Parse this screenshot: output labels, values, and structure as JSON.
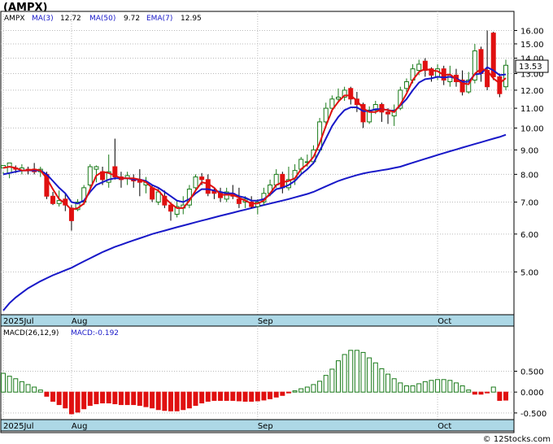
{
  "title": "(AMPX)",
  "watermark": "© 12Stocks.com",
  "colors": {
    "up": "#1a7a1a",
    "down": "#e01010",
    "ma3": "#e01010",
    "ma50": "#1818c8",
    "ema7": "#1818c8",
    "axisband": "#add8e6",
    "grid": "#bbbbbb",
    "macd_pos": "#1a7a1a",
    "macd_neg": "#e01010"
  },
  "legend": {
    "symbol": "AMPX",
    "ma3_label": "MA(3)",
    "ma3_value": "12.72",
    "ma50_label": "MA(50)",
    "ma50_value": "9.72",
    "ema7_label": "EMA(7)",
    "ema7_value": "12.95"
  },
  "macd_legend": {
    "label": "MACD(26,12,9)",
    "value_label": "MACD:-0.192"
  },
  "last_price_label": "13.53",
  "chart_data": [
    {
      "type": "candlestick",
      "title": "(AMPX)",
      "y_scale": "log",
      "ylim": [
        4.1,
        17.0
      ],
      "yticks": [
        "16.00",
        "15.00",
        "14.00",
        "13.00",
        "12.00",
        "11.00",
        "10.00",
        "9.00",
        "8.00",
        "7.00",
        "6.00",
        "5.00"
      ],
      "ytick_values": [
        16,
        15,
        14,
        13,
        12,
        11,
        10,
        9,
        8,
        7,
        6,
        5
      ],
      "xticks": [
        {
          "label": "2025Jul",
          "index": 0
        },
        {
          "label": "Aug",
          "index": 11
        },
        {
          "label": "Sep",
          "index": 41
        },
        {
          "label": "Oct",
          "index": 70
        }
      ],
      "candles": [
        [
          8.25,
          8.35,
          8.1,
          8.0
        ],
        [
          8.05,
          8.45,
          8.25,
          7.85
        ],
        [
          8.25,
          8.2,
          8.35,
          8.05
        ],
        [
          8.15,
          8.25,
          8.4,
          8.0
        ],
        [
          8.2,
          8.15,
          8.3,
          8.0
        ],
        [
          8.2,
          8.1,
          8.45,
          8.0
        ],
        [
          8.1,
          8.2,
          8.3,
          7.9
        ],
        [
          8.0,
          7.2,
          8.1,
          7.1
        ],
        [
          7.2,
          6.95,
          7.35,
          6.9
        ],
        [
          6.95,
          7.05,
          7.4,
          6.85
        ],
        [
          7.1,
          6.9,
          7.3,
          6.7
        ],
        [
          6.8,
          6.4,
          6.9,
          6.1
        ],
        [
          6.75,
          7.0,
          7.1,
          6.7
        ],
        [
          7.0,
          7.5,
          7.6,
          6.9
        ],
        [
          7.6,
          8.3,
          8.4,
          7.5
        ],
        [
          8.2,
          8.3,
          8.35,
          7.7
        ],
        [
          8.1,
          7.8,
          8.3,
          7.6
        ],
        [
          7.7,
          8.1,
          8.8,
          7.5
        ],
        [
          8.3,
          7.9,
          9.5,
          7.8
        ],
        [
          7.9,
          7.8,
          8.1,
          7.5
        ],
        [
          7.85,
          7.95,
          8.1,
          7.6
        ],
        [
          7.8,
          7.75,
          8.0,
          7.5
        ],
        [
          7.8,
          7.7,
          8.2,
          7.2
        ],
        [
          7.6,
          7.7,
          7.9,
          7.3
        ],
        [
          7.5,
          7.1,
          7.6,
          7.0
        ],
        [
          7.0,
          7.35,
          7.5,
          6.9
        ],
        [
          7.2,
          6.9,
          7.4,
          6.8
        ],
        [
          6.9,
          6.7,
          7.0,
          6.4
        ],
        [
          6.6,
          6.85,
          7.05,
          6.5
        ],
        [
          6.8,
          6.9,
          7.2,
          6.6
        ],
        [
          6.9,
          7.45,
          7.6,
          6.8
        ],
        [
          7.5,
          7.9,
          8.0,
          7.4
        ],
        [
          7.9,
          7.8,
          8.05,
          7.6
        ],
        [
          7.8,
          7.3,
          8.0,
          7.2
        ],
        [
          7.4,
          7.3,
          7.5,
          7.1
        ],
        [
          7.3,
          7.15,
          7.5,
          7.0
        ],
        [
          7.1,
          7.35,
          7.5,
          7.0
        ],
        [
          7.3,
          7.2,
          7.6,
          7.1
        ],
        [
          7.1,
          6.95,
          7.5,
          6.8
        ],
        [
          7.0,
          7.1,
          7.2,
          6.8
        ],
        [
          7.0,
          6.85,
          7.2,
          6.8
        ],
        [
          6.85,
          7.0,
          7.1,
          6.6
        ],
        [
          7.0,
          7.3,
          7.5,
          6.9
        ],
        [
          7.3,
          7.6,
          7.8,
          7.2
        ],
        [
          7.6,
          8.0,
          8.2,
          7.5
        ],
        [
          8.0,
          7.5,
          8.1,
          7.3
        ],
        [
          7.5,
          7.8,
          8.3,
          7.4
        ],
        [
          7.8,
          8.15,
          8.4,
          7.6
        ],
        [
          8.2,
          8.6,
          8.7,
          8.0
        ],
        [
          8.5,
          8.5,
          8.8,
          8.3
        ],
        [
          8.5,
          9.0,
          9.2,
          8.4
        ],
        [
          9.0,
          10.3,
          10.5,
          8.9
        ],
        [
          10.3,
          11.0,
          11.3,
          10.0
        ],
        [
          11.0,
          11.5,
          11.7,
          10.8
        ],
        [
          11.5,
          11.6,
          12.1,
          11.3
        ],
        [
          11.6,
          12.0,
          12.2,
          11.4
        ],
        [
          12.1,
          11.5,
          12.2,
          11.2
        ],
        [
          11.5,
          11.2,
          11.9,
          10.8
        ],
        [
          11.2,
          10.3,
          11.3,
          10.0
        ],
        [
          10.3,
          10.9,
          11.1,
          10.2
        ],
        [
          10.9,
          11.2,
          11.4,
          10.7
        ],
        [
          11.2,
          10.8,
          11.3,
          10.3
        ],
        [
          10.8,
          10.7,
          11.0,
          10.2
        ],
        [
          10.6,
          10.9,
          11.2,
          10.1
        ],
        [
          11.0,
          12.0,
          12.2,
          10.9
        ],
        [
          12.1,
          12.5,
          12.7,
          11.9
        ],
        [
          12.6,
          13.3,
          13.6,
          12.4
        ],
        [
          13.2,
          13.6,
          13.9,
          12.9
        ],
        [
          13.8,
          13.2,
          14.0,
          12.8
        ],
        [
          13.3,
          12.9,
          13.4,
          12.5
        ],
        [
          12.8,
          13.3,
          13.6,
          12.6
        ],
        [
          13.3,
          12.6,
          13.5,
          12.3
        ],
        [
          12.5,
          12.9,
          13.5,
          12.2
        ],
        [
          12.9,
          12.5,
          13.3,
          12.2
        ],
        [
          12.6,
          11.9,
          13.2,
          11.7
        ],
        [
          11.9,
          12.6,
          13.1,
          11.8
        ],
        [
          12.6,
          14.5,
          15.0,
          12.4
        ],
        [
          14.6,
          13.0,
          14.8,
          12.5
        ],
        [
          13.2,
          12.2,
          16.0,
          12.0
        ],
        [
          15.8,
          12.8,
          15.9,
          12.6
        ],
        [
          12.8,
          11.8,
          13.0,
          11.6
        ],
        [
          12.2,
          13.53,
          13.9,
          12.0
        ]
      ],
      "series": [
        {
          "name": "MA(3)",
          "values": [
            8.25,
            8.3,
            8.25,
            8.15,
            8.15,
            8.2,
            8.15,
            7.85,
            7.45,
            7.1,
            6.95,
            6.75,
            6.8,
            6.95,
            7.45,
            7.95,
            8.1,
            8.05,
            7.95,
            7.85,
            7.85,
            7.85,
            7.8,
            7.7,
            7.5,
            7.4,
            7.15,
            6.95,
            6.8,
            6.8,
            7.05,
            7.4,
            7.7,
            7.65,
            7.5,
            7.25,
            7.25,
            7.25,
            7.15,
            7.05,
            6.95,
            6.95,
            7.05,
            7.3,
            7.6,
            7.7,
            7.75,
            7.85,
            8.2,
            8.4,
            8.7,
            9.3,
            10.1,
            10.9,
            11.35,
            11.7,
            11.7,
            11.4,
            11.0,
            10.8,
            10.8,
            10.95,
            10.9,
            10.8,
            11.2,
            11.8,
            12.6,
            13.1,
            13.3,
            13.2,
            13.15,
            12.9,
            12.95,
            12.65,
            12.4,
            12.35,
            13.0,
            13.3,
            13.2,
            12.7,
            12.4,
            12.72
          ]
        },
        {
          "name": "EMA(7)",
          "values": [
            8.0,
            8.05,
            8.1,
            8.15,
            8.15,
            8.15,
            8.15,
            8.0,
            7.75,
            7.5,
            7.3,
            7.0,
            6.95,
            7.05,
            7.35,
            7.6,
            7.7,
            7.8,
            7.85,
            7.85,
            7.85,
            7.8,
            7.8,
            7.75,
            7.6,
            7.5,
            7.35,
            7.2,
            7.05,
            7.0,
            7.1,
            7.3,
            7.45,
            7.45,
            7.4,
            7.35,
            7.3,
            7.3,
            7.2,
            7.15,
            7.05,
            7.05,
            7.1,
            7.25,
            7.45,
            7.5,
            7.6,
            7.75,
            8.0,
            8.2,
            8.45,
            8.95,
            9.5,
            10.1,
            10.55,
            10.9,
            11.05,
            11.05,
            10.85,
            10.85,
            10.95,
            10.95,
            10.9,
            10.85,
            11.15,
            11.5,
            12.0,
            12.45,
            12.65,
            12.7,
            12.8,
            12.75,
            12.8,
            12.7,
            12.5,
            12.5,
            12.95,
            13.0,
            13.4,
            13.2,
            12.9,
            12.95
          ]
        },
        {
          "name": "MA(50)",
          "values": [
            4.15,
            4.3,
            4.42,
            4.52,
            4.62,
            4.7,
            4.78,
            4.85,
            4.92,
            4.98,
            5.04,
            5.1,
            5.18,
            5.26,
            5.34,
            5.42,
            5.5,
            5.57,
            5.64,
            5.7,
            5.76,
            5.82,
            5.88,
            5.94,
            6.0,
            6.05,
            6.1,
            6.15,
            6.2,
            6.25,
            6.3,
            6.35,
            6.4,
            6.45,
            6.5,
            6.55,
            6.6,
            6.65,
            6.7,
            6.75,
            6.8,
            6.85,
            6.9,
            6.95,
            7.0,
            7.05,
            7.1,
            7.16,
            7.22,
            7.28,
            7.35,
            7.45,
            7.55,
            7.65,
            7.75,
            7.83,
            7.9,
            7.97,
            8.03,
            8.08,
            8.12,
            8.16,
            8.2,
            8.25,
            8.3,
            8.38,
            8.46,
            8.54,
            8.62,
            8.7,
            8.78,
            8.86,
            8.94,
            9.02,
            9.1,
            9.18,
            9.26,
            9.34,
            9.42,
            9.5,
            9.58,
            9.68
          ]
        }
      ]
    },
    {
      "type": "bar",
      "title": "MACD(26,12,9)",
      "ylim": [
        -0.62,
        1.25
      ],
      "yticks": [
        "0.500",
        "0.000",
        "-0.500"
      ],
      "ytick_values": [
        0.5,
        0.0,
        -0.5
      ],
      "xticks": [
        {
          "label": "2025Jul",
          "index": 0
        },
        {
          "label": "Aug",
          "index": 11
        },
        {
          "label": "Sep",
          "index": 41
        },
        {
          "label": "Oct",
          "index": 70
        }
      ],
      "values": [
        0.45,
        0.38,
        0.32,
        0.25,
        0.18,
        0.12,
        0.05,
        -0.1,
        -0.22,
        -0.3,
        -0.38,
        -0.52,
        -0.48,
        -0.4,
        -0.32,
        -0.28,
        -0.26,
        -0.26,
        -0.28,
        -0.3,
        -0.3,
        -0.3,
        -0.32,
        -0.35,
        -0.38,
        -0.42,
        -0.44,
        -0.45,
        -0.45,
        -0.42,
        -0.38,
        -0.32,
        -0.26,
        -0.22,
        -0.2,
        -0.2,
        -0.2,
        -0.2,
        -0.21,
        -0.22,
        -0.22,
        -0.21,
        -0.19,
        -0.16,
        -0.12,
        -0.08,
        -0.02,
        0.03,
        0.08,
        0.12,
        0.18,
        0.26,
        0.4,
        0.55,
        0.75,
        0.9,
        1.0,
        1.0,
        0.95,
        0.82,
        0.7,
        0.56,
        0.43,
        0.32,
        0.22,
        0.15,
        0.15,
        0.2,
        0.25,
        0.28,
        0.3,
        0.3,
        0.28,
        0.22,
        0.15,
        0.05,
        -0.05,
        -0.05,
        -0.02,
        0.12,
        -0.2,
        -0.192
      ]
    }
  ]
}
